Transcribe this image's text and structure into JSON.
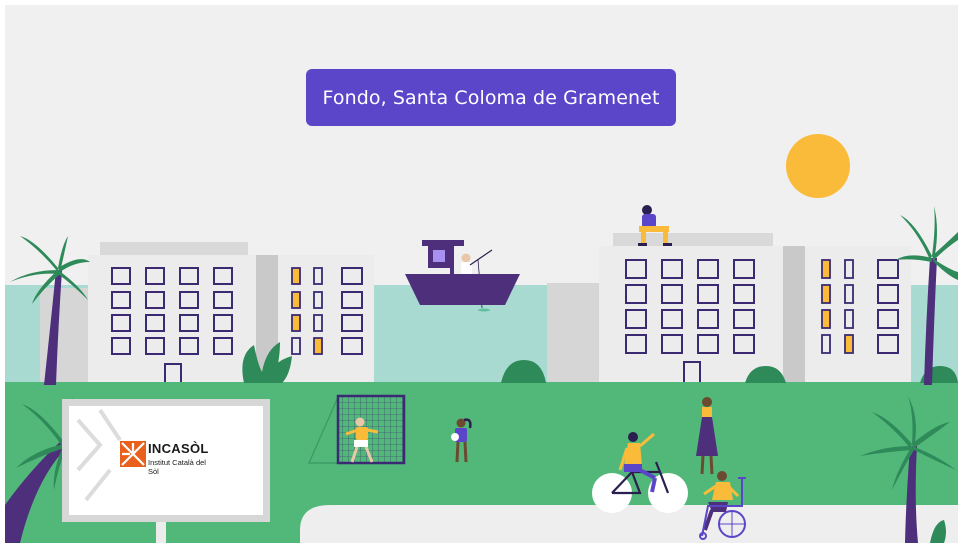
{
  "location_title": "Fondo, Santa Coloma de Gramenet",
  "billboard": {
    "brand": "INCASÒL",
    "subtitle": "Institut Català del Sòl"
  },
  "colors": {
    "sky": "#f0f0f0",
    "water": "#a9dad1",
    "grass": "#52b87a",
    "path": "#eeeeee",
    "badge": "#5b45c9",
    "sun": "#fbbb3a",
    "building_light": "#ececec",
    "building_shade": "#cfcfcf",
    "window_outline": "#3b2a72",
    "window_lit": "#fbbb3a",
    "palm_trunk": "#4d2f7c",
    "palm_leaves": "#2f8a5a",
    "logo_orange": "#e8601c"
  }
}
